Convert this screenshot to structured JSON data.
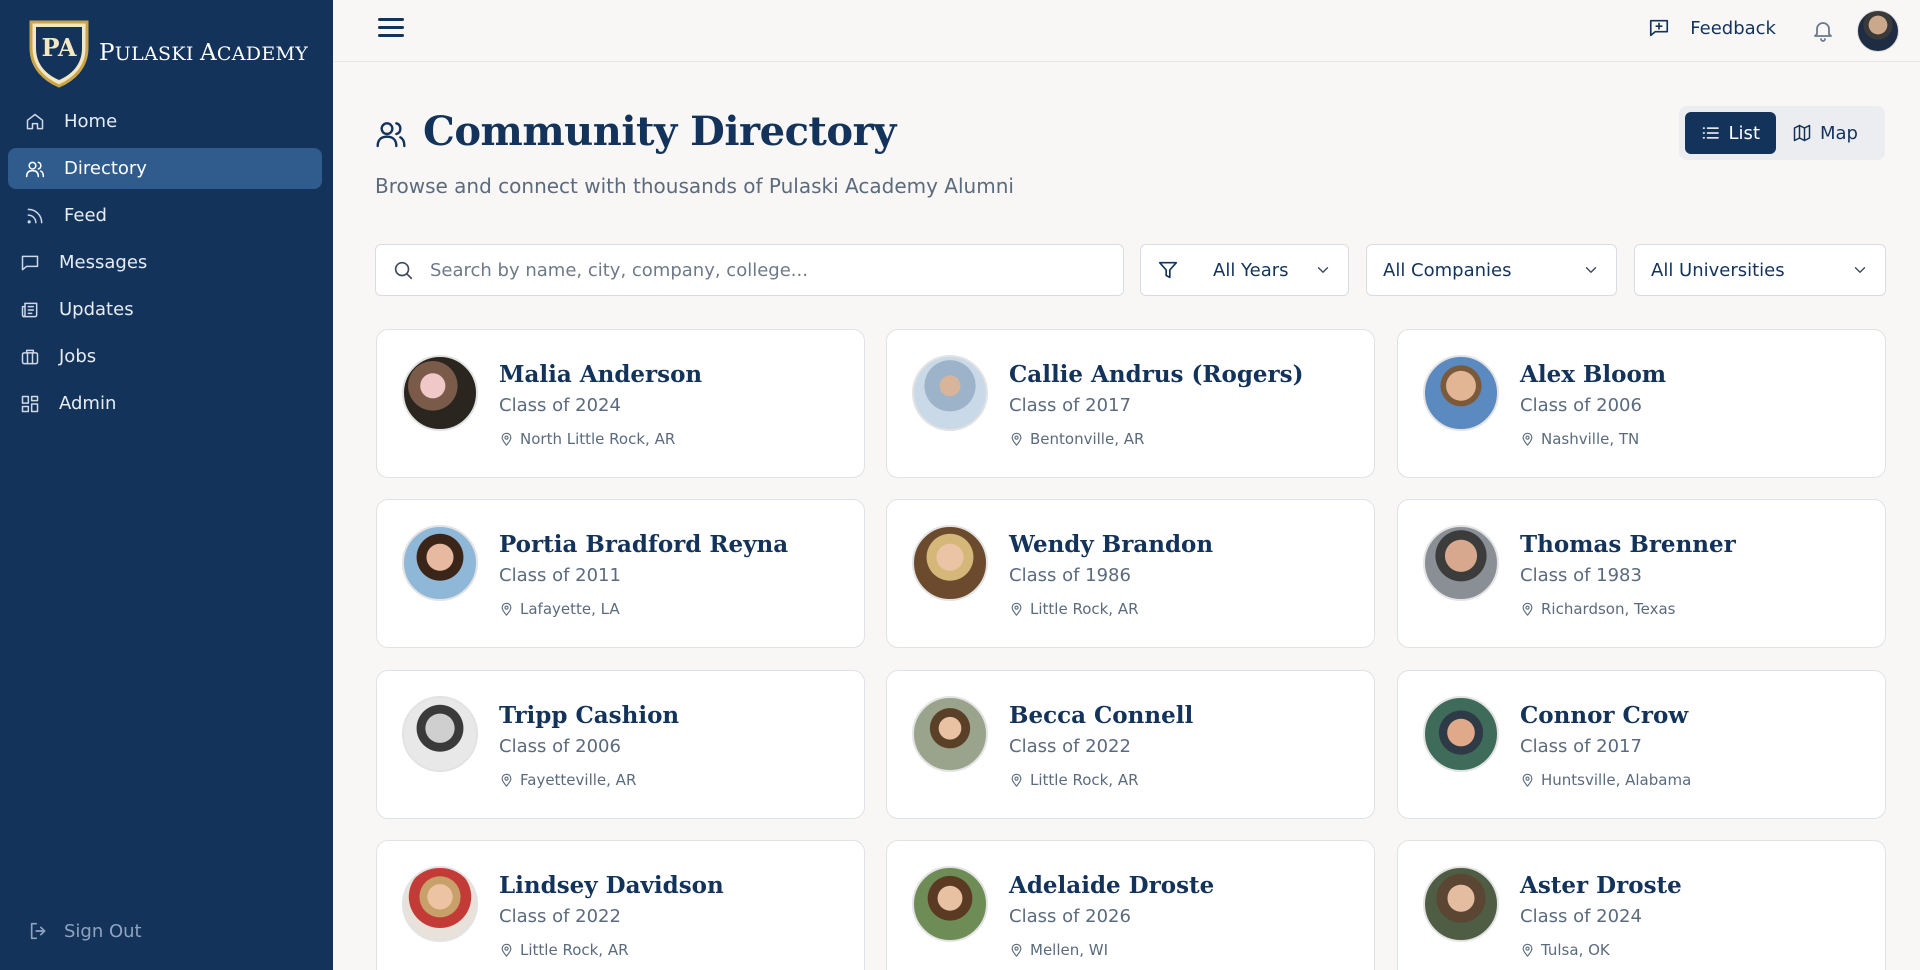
{
  "sidebar": {
    "brand_initials": "PA",
    "brand_name_first": "P",
    "brand_name_rest": "ULASKI ",
    "brand_name_second_first": "A",
    "brand_name_second_rest": "CADEMY",
    "items": [
      {
        "label": "Home",
        "icon": "home-icon"
      },
      {
        "label": "Directory",
        "icon": "users-icon",
        "active": true
      },
      {
        "label": "Feed",
        "icon": "rss-icon"
      },
      {
        "label": "Messages",
        "icon": "message-icon"
      },
      {
        "label": "Updates",
        "icon": "newspaper-icon"
      },
      {
        "label": "Jobs",
        "icon": "briefcase-icon"
      },
      {
        "label": "Admin",
        "icon": "grid-icon"
      }
    ],
    "signout_label": "Sign Out"
  },
  "topbar": {
    "feedback_label": "Feedback"
  },
  "header": {
    "title": "Community Directory",
    "subtitle": "Browse and connect with thousands of Pulaski Academy Alumni",
    "view_list_label": "List",
    "view_map_label": "Map",
    "active_view": "List"
  },
  "filters": {
    "search_placeholder": "Search by name, city, company, college...",
    "years": "All Years",
    "companies": "All Companies",
    "universities": "All Universities"
  },
  "people": [
    {
      "name": "Malia Anderson",
      "class": "Class of 2024",
      "location": "North Little Rock, AR"
    },
    {
      "name": "Callie Andrus (Rogers)",
      "class": "Class of 2017",
      "location": "Bentonville, AR"
    },
    {
      "name": "Alex Bloom",
      "class": "Class of 2006",
      "location": "Nashville, TN"
    },
    {
      "name": "Portia Bradford Reyna",
      "class": "Class of 2011",
      "location": "Lafayette, LA"
    },
    {
      "name": "Wendy Brandon",
      "class": "Class of 1986",
      "location": "Little Rock, AR"
    },
    {
      "name": "Thomas Brenner",
      "class": "Class of 1983",
      "location": "Richardson, Texas"
    },
    {
      "name": "Tripp Cashion",
      "class": "Class of 2006",
      "location": "Fayetteville, AR"
    },
    {
      "name": "Becca Connell",
      "class": "Class of 2022",
      "location": "Little Rock, AR"
    },
    {
      "name": "Connor Crow",
      "class": "Class of 2017",
      "location": "Huntsville, Alabama"
    },
    {
      "name": "Lindsey Davidson",
      "class": "Class of 2022",
      "location": "Little Rock, AR"
    },
    {
      "name": "Adelaide Droste",
      "class": "Class of 2026",
      "location": "Mellen, WI"
    },
    {
      "name": "Aster Droste",
      "class": "Class of 2024",
      "location": "Tulsa, OK"
    }
  ],
  "colors": {
    "sidebar_bg": "#13335b",
    "accent": "#13335b",
    "active_nav": "#2f5b8d",
    "page_bg": "#f8f7f5"
  }
}
